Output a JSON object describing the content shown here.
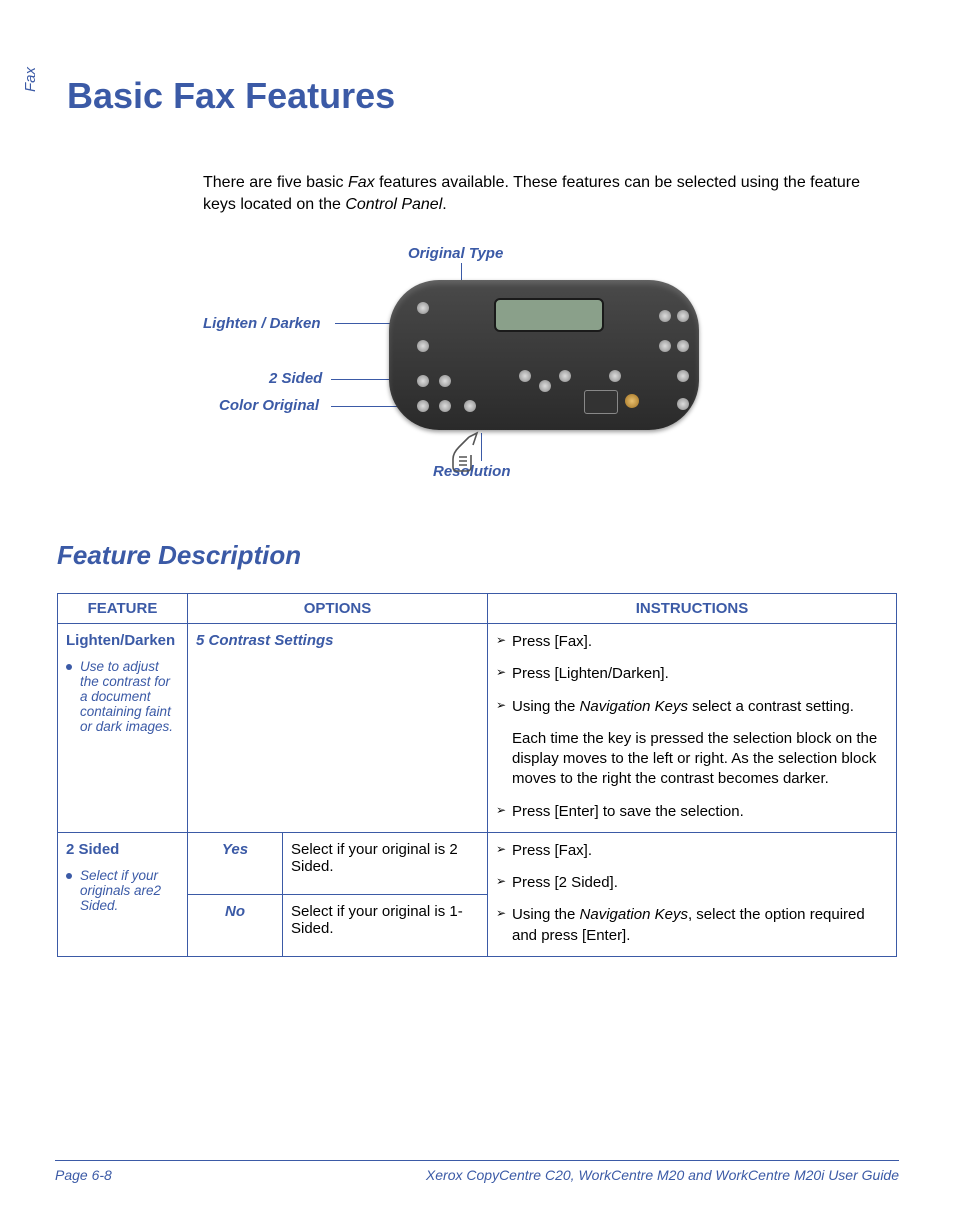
{
  "sideLabel": "Fax",
  "title": "Basic Fax Features",
  "intro": {
    "pre": "There are five basic ",
    "fax": "Fax",
    "mid": " features available. These features can be selected using the feature keys located on the ",
    "panel": "Control Panel",
    "post": "."
  },
  "callouts": {
    "originalType": "Original Type",
    "lightenDarken": "Lighten / Darken",
    "twoSided": "2 Sided",
    "colorOriginal": "Color Original",
    "resolution": "Resolution"
  },
  "sectionHeading": "Feature Description",
  "headers": {
    "feature": "FEATURE",
    "options": "OPTIONS",
    "instructions": "INSTRUCTIONS"
  },
  "row1": {
    "name": "Lighten/Darken",
    "note": "Use to adjust the contrast for a document containing faint or dark images.",
    "optionsHeader": "5 Contrast Settings",
    "instr": {
      "i1": "Press [Fax].",
      "i2": "Press [Lighten/Darken].",
      "i3_pre": "Using the ",
      "i3_nav": "Navigation Keys",
      "i3_post": " select a contrast setting.",
      "i4": "Each time the key is pressed the selection block on the display moves to the left or right. As the selection block moves to the right the contrast becomes darker.",
      "i5": "Press [Enter] to save the selection."
    }
  },
  "row2": {
    "name": "2 Sided",
    "note": "Select if your originals are2 Sided.",
    "optYes": "Yes",
    "optYesDesc": "Select if your original is 2 Sided.",
    "optNo": "No",
    "optNoDesc": "Select if your original is 1-Sided.",
    "instr": {
      "i1": "Press [Fax].",
      "i2": "Press [2 Sided].",
      "i3_pre": "Using the ",
      "i3_nav": "Navigation Keys",
      "i3_post": ", select the option required and press [Enter]."
    }
  },
  "footer": {
    "left": "Page 6-8",
    "right": "Xerox CopyCentre C20, WorkCentre M20 and WorkCentre M20i User Guide"
  }
}
